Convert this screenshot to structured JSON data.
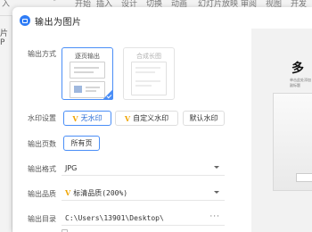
{
  "background_app": {
    "ribbon_items": [
      "入",
      "ﾞ",
      "开始",
      "插入",
      "设计",
      "切换",
      "动画",
      "幻灯片放映",
      "审阅",
      "视图",
      "开发工具"
    ],
    "left_strip_text": "片P"
  },
  "dialog": {
    "title": "输出为图片",
    "output_mode": {
      "label": "输出方式",
      "options": [
        {
          "label": "逐页输出",
          "selected": true
        },
        {
          "label": "合成长图",
          "selected": false
        }
      ]
    },
    "watermark": {
      "label": "水印设置",
      "options": [
        {
          "label": "无水印",
          "vip": true,
          "active": true
        },
        {
          "label": "自定义水印",
          "vip": true,
          "active": false
        },
        {
          "label": "默认水印",
          "vip": false,
          "active": false
        }
      ],
      "vip_glyph": "V"
    },
    "pages": {
      "label": "输出页数",
      "value": "所有页"
    },
    "format": {
      "label": "输出格式",
      "value": "JPG"
    },
    "quality": {
      "label": "输出品质",
      "vip_glyph": "V",
      "value": "标清品质(200%)"
    },
    "directory": {
      "label": "输出目录",
      "value": "C:\\Users\\13901\\Desktop\\",
      "browse": "···"
    }
  },
  "preview": {
    "big_text": "多",
    "small_text": "单击此处添加副标题"
  },
  "colors": {
    "accent": "#4a8ef7",
    "vip": "#f0a400"
  }
}
